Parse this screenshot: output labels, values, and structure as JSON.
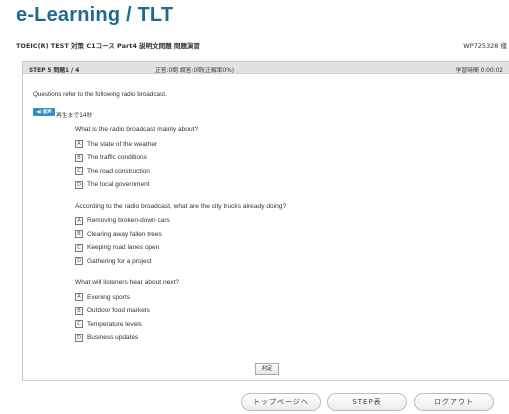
{
  "header": {
    "app_title": "e-Learning / TLT",
    "course_title": "TOEIC(R) TEST 対策 C1コース Part4 説明文問題 問題演習",
    "user_id": "WP725328 様"
  },
  "status": {
    "step": "STEP 5 問題1 / 4",
    "score": "正答:0問 誤答:0問(正解率0%)",
    "timer": "学習時間 0:00:02"
  },
  "intro": "Questions refer to the following radio broadcast.",
  "play": {
    "icon": "speaker-icon",
    "label": "音声",
    "message": "再生まで14秒"
  },
  "questions": [
    {
      "text": "What is the radio broadcast mainly about?",
      "options": [
        {
          "letter": "A",
          "text": "The state of the weather"
        },
        {
          "letter": "B",
          "text": "The traffic conditions"
        },
        {
          "letter": "C",
          "text": "The road construction"
        },
        {
          "letter": "D",
          "text": "The local government"
        }
      ]
    },
    {
      "text": "According to the radio broadcast, what are the city trucks already doing?",
      "options": [
        {
          "letter": "A",
          "text": "Removing broken-down cars"
        },
        {
          "letter": "B",
          "text": "Clearing away fallen trees"
        },
        {
          "letter": "C",
          "text": "Keeping road lanes open"
        },
        {
          "letter": "D",
          "text": "Gathering for a project"
        }
      ]
    },
    {
      "text": "What will listeners hear about next?",
      "options": [
        {
          "letter": "A",
          "text": "Evening sports"
        },
        {
          "letter": "B",
          "text": "Outdoor food markets"
        },
        {
          "letter": "C",
          "text": "Temperature levels"
        },
        {
          "letter": "D",
          "text": "Business updates"
        }
      ]
    }
  ],
  "judge_label": "判定",
  "footer": {
    "top_page": "トップページへ",
    "step_table": "STEP表",
    "logout": "ログアウト"
  }
}
